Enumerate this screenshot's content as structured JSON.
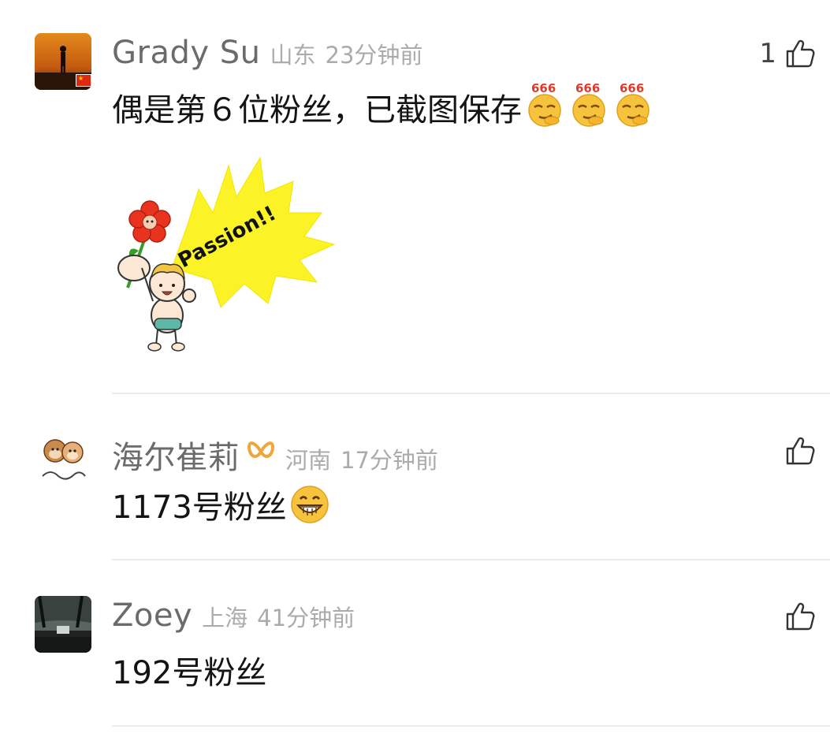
{
  "comments": [
    {
      "username": "Grady Su",
      "location": "山东",
      "time": "23分钟前",
      "like_count": "1",
      "text": "偶是第６位粉丝，已截图保存",
      "emoji_label": "666",
      "sticker_text": "Passion!!"
    },
    {
      "username": "海尔崔莉",
      "location": "河南",
      "time": "17分钟前",
      "like_count": "",
      "text": "1173号粉丝"
    },
    {
      "username": "Zoey",
      "location": "上海",
      "time": "41分钟前",
      "like_count": "",
      "text": "192号粉丝"
    }
  ],
  "icons": {
    "like": "thumbs-up-icon",
    "emoji_666": "smug-666-emoji-icon",
    "emoji_grin": "grinning-emoji-icon",
    "badge": "vip-badge-icon",
    "flag": "china-flag-icon"
  },
  "colors": {
    "username": "#6b6b6b",
    "meta": "#ababab",
    "text": "#141414",
    "divider": "#ececec",
    "badge": "#f0a63a"
  }
}
